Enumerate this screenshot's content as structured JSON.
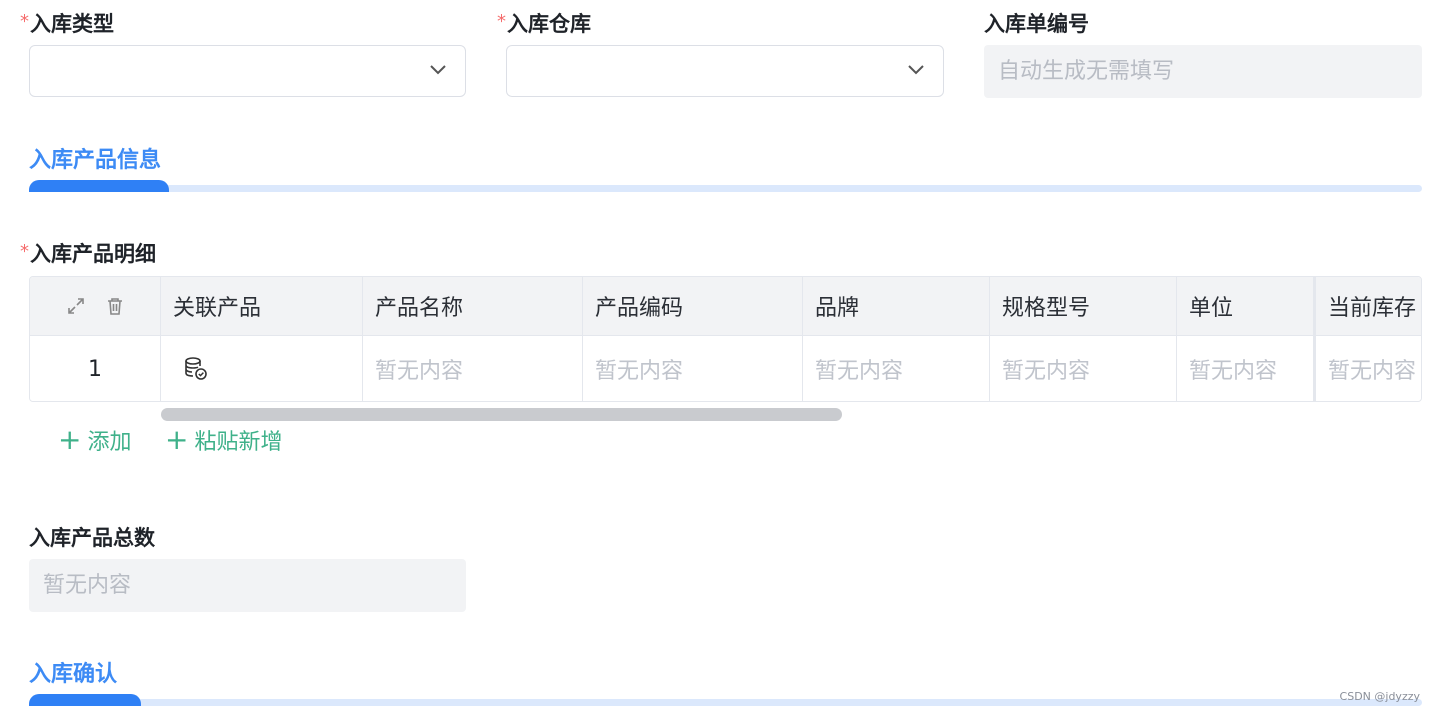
{
  "form": {
    "type_label": "入库类型",
    "warehouse_label": "入库仓库",
    "number_label": "入库单编号",
    "number_placeholder": "自动生成无需填写",
    "required_mark": "*"
  },
  "sections": {
    "product_info": "入库产品信息",
    "confirm": "入库确认"
  },
  "detail": {
    "label": "入库产品明细",
    "columns": [
      "关联产品",
      "产品名称",
      "产品编码",
      "品牌",
      "规格型号",
      "单位",
      "当前库存"
    ],
    "row": {
      "index": "1",
      "empty": "暂无内容"
    },
    "actions": {
      "add": "添加",
      "paste_add": "粘贴新增"
    }
  },
  "total": {
    "label": "入库产品总数",
    "value": "暂无内容"
  },
  "watermark": "CSDN @jdyzzy",
  "colors": {
    "accent": "#2f80f5",
    "action_green": "#3fb18a",
    "required_red": "#f56c6c"
  }
}
